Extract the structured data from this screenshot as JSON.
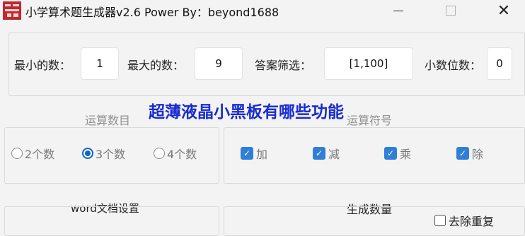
{
  "window": {
    "title": "小学算术题生成器v2.6  Power By：beyond1688",
    "minimize_icon": "minimize-icon",
    "maximize_icon": "maximize-icon",
    "close_glyph": "✕"
  },
  "range": {
    "min_label": "最小的数：",
    "min_value": "1",
    "max_label": "最大的数：",
    "max_value": "9",
    "answer_label": "答案筛选：",
    "answer_value": "[1,100]",
    "decimal_label": "小数位数：",
    "decimal_value": "0"
  },
  "operand_count": {
    "title": "运算数目",
    "options": [
      {
        "label": "2个数",
        "selected": false
      },
      {
        "label": "3个数",
        "selected": true
      },
      {
        "label": "4个数",
        "selected": false
      }
    ]
  },
  "operators": {
    "title": "运算符号",
    "options": [
      {
        "label": "加",
        "checked": true
      },
      {
        "label": "减",
        "checked": true
      },
      {
        "label": "乘",
        "checked": true
      },
      {
        "label": "除",
        "checked": true
      }
    ]
  },
  "word_settings": {
    "title": "word文档设置"
  },
  "generate": {
    "title": "生成数量",
    "dedupe_label": "去除重复",
    "dedupe_checked": false
  },
  "overlay_text": "超薄液晶小黑板有哪些功能",
  "colors": {
    "accent": "#0a67c4",
    "checkbox": "#2f7fd8",
    "overlay": "#1a2bd0",
    "icon_red": "#c0282d"
  }
}
